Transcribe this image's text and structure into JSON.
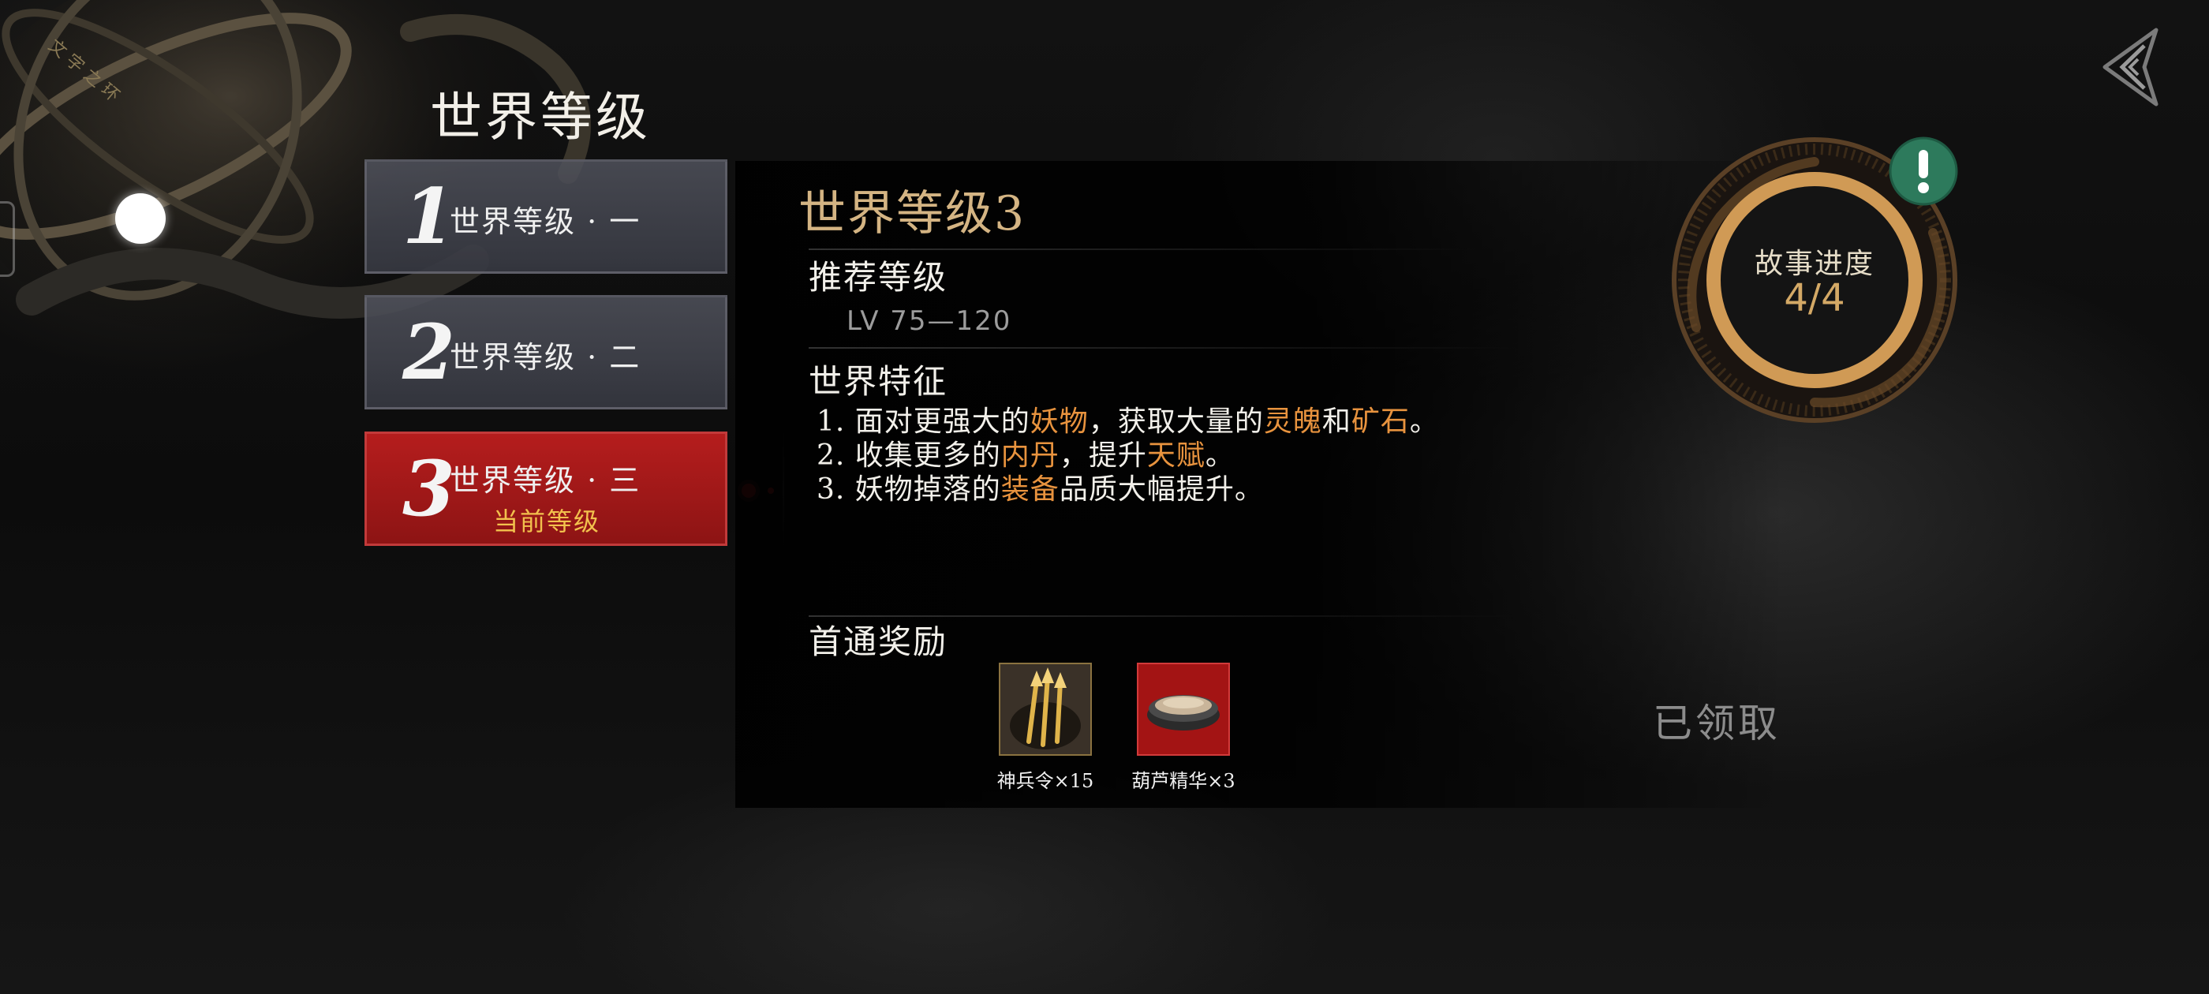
{
  "page": {
    "title": "世界等级"
  },
  "levels": [
    {
      "number": "1",
      "label": "世界等级 · 一",
      "sublabel": ""
    },
    {
      "number": "2",
      "label": "世界等级 · 二",
      "sublabel": ""
    },
    {
      "number": "3",
      "label": "世界等级 · 三",
      "sublabel": "当前等级"
    }
  ],
  "selected_level_index": 3,
  "detail": {
    "title": "世界等级3",
    "recommended_heading": "推荐等级",
    "recommended_range": "LV 75—120",
    "features_heading": "世界特征",
    "features": [
      {
        "p1": "1. 面对更强大的",
        "h1": "妖物",
        "p2": "，获取大量的",
        "h2": "灵魄",
        "p3": "和",
        "h3": "矿石",
        "p4": "。"
      },
      {
        "p1": "2. 收集更多的",
        "h1": "内丹",
        "p2": "，提升",
        "h2": "天赋",
        "p3": "。"
      },
      {
        "p1": "3. 妖物掉落的",
        "h1": "装备",
        "p2": "品质大幅提升。"
      }
    ],
    "rewards_heading": "首通奖励",
    "rewards": [
      {
        "name": "神兵令×15",
        "icon": "golden-arrows-icon"
      },
      {
        "name": "葫芦精华×3",
        "icon": "dust-bowl-icon"
      }
    ],
    "claim_status": "已领取"
  },
  "story": {
    "label": "故事进度",
    "value": "4/4",
    "progress": 1.0
  },
  "colors": {
    "highlight": "#e8933e",
    "title_gold": "#d4b483",
    "active_tab": "#a81818",
    "sublabel_gold": "#f2c14d",
    "ring_gold": "#d09a55",
    "alert_green": "#2d7a5c"
  },
  "icons": {
    "close": "back-arrow-icon",
    "alert": "exclamation-icon"
  }
}
